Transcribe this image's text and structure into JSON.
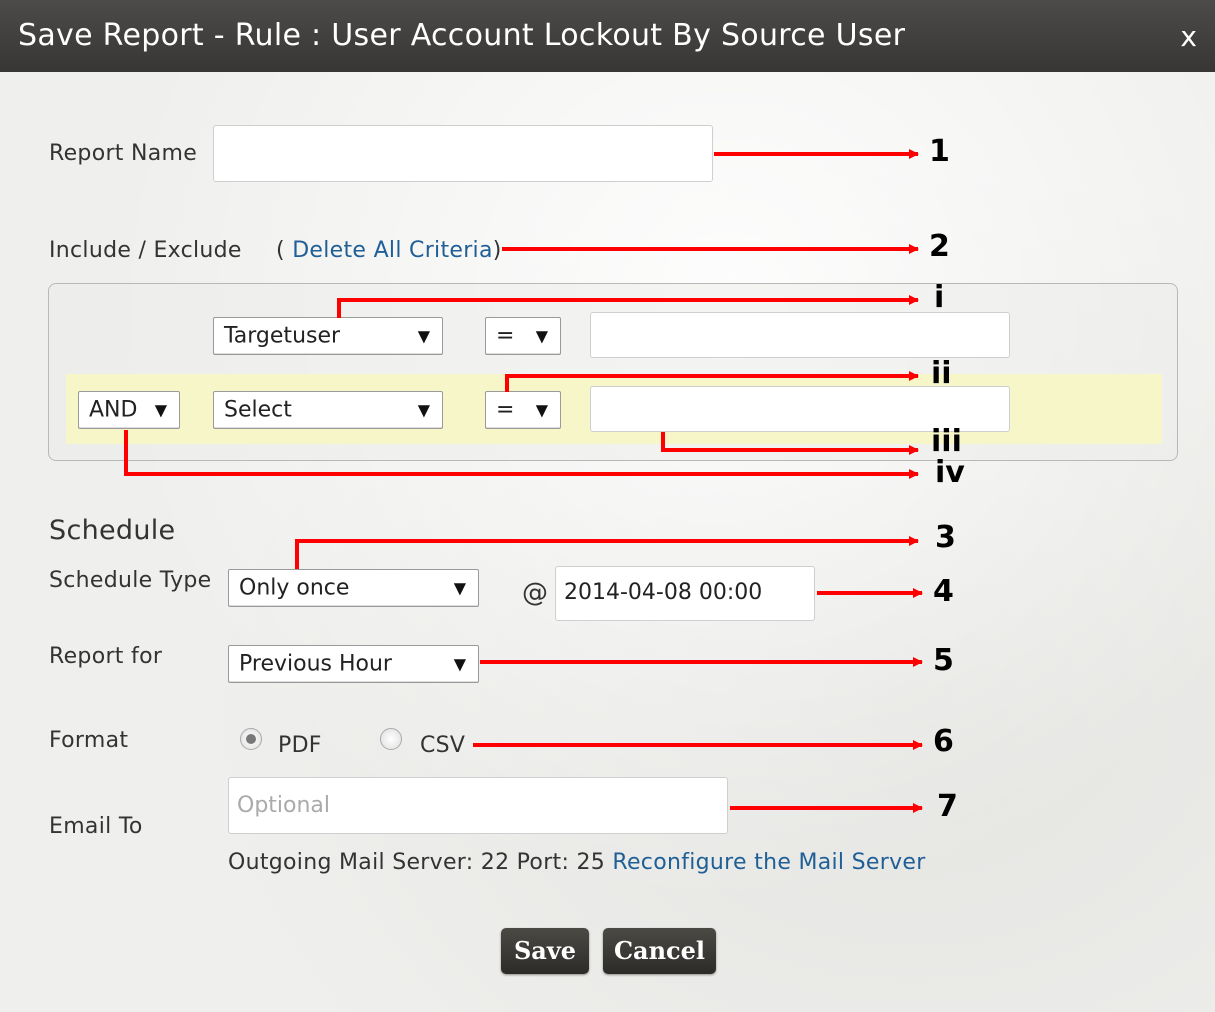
{
  "dialog": {
    "title": "Save Report - Rule : User Account Lockout By Source User",
    "close_label": "x"
  },
  "report_name": {
    "label": "Report Name",
    "value": ""
  },
  "include_exclude": {
    "label": "Include / Exclude",
    "delete_prefix": "(",
    "delete_link": "Delete All Criteria",
    "delete_suffix": ")"
  },
  "criteria": [
    {
      "field": "Targetuser",
      "operator": "=",
      "value": ""
    },
    {
      "conjunction": "AND",
      "field": "Select",
      "operator": "=",
      "value": ""
    }
  ],
  "schedule": {
    "heading": "Schedule",
    "type_label": "Schedule Type",
    "type_value": "Only once",
    "at_symbol": "@",
    "datetime": "2014-04-08 00:00",
    "report_for_label": "Report for",
    "report_for_value": "Previous Hour"
  },
  "format": {
    "label": "Format",
    "options": [
      {
        "label": "PDF",
        "checked": true
      },
      {
        "label": "CSV",
        "checked": false
      }
    ]
  },
  "email": {
    "label": "Email To",
    "placeholder": "Optional",
    "mail_info": "Outgoing Mail Server: 22  Port: 25",
    "reconfigure_link": "Reconfigure the Mail Server"
  },
  "buttons": {
    "save": "Save",
    "cancel": "Cancel"
  },
  "annotations": [
    "1",
    "2",
    "i",
    "ii",
    "iii",
    "iv",
    "3",
    "4",
    "5",
    "6",
    "7"
  ],
  "colors": {
    "titlebar": "#3f3d3b",
    "annotation_arrow": "#ff0000",
    "link": "#1f5f96",
    "highlight_row": "#f6f6c8"
  }
}
